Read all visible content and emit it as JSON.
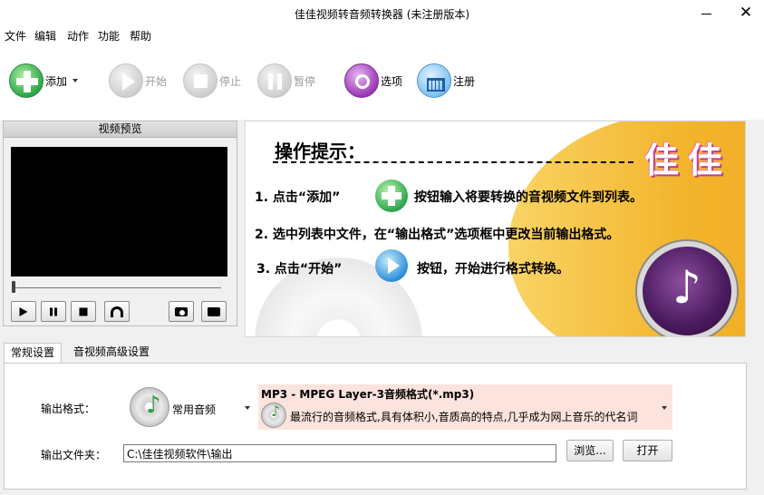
{
  "window": {
    "title": "佳佳视频转音频转换器  (未注册版本)",
    "close_glyph": "✕"
  },
  "menu": [
    "文件",
    "编辑",
    "动作",
    "功能",
    "帮助"
  ],
  "toolbar": {
    "add": "添加",
    "start": "开始",
    "stop": "停止",
    "pause": "暂停",
    "options": "选项",
    "register": "注册"
  },
  "preview": {
    "title": "视频预览"
  },
  "banner": {
    "heading": "操作提示：",
    "brand": "佳佳",
    "step1_a": "1. 点击“添加”",
    "step1_b": "按钮输入将要转换的音视频文件到列表。",
    "step2": "2. 选中列表中文件，在“输出格式”选项框中更改当前输出格式。",
    "step3_a": "3. 点击“开始”",
    "step3_b": "按钮，开始进行格式转换。",
    "music_glyph": "♪"
  },
  "tabs": [
    "常规设置",
    "音视频高级设置"
  ],
  "settings": {
    "format_label": "输出格式：",
    "format_category": "常用音频",
    "format_name": "MP3 - MPEG Layer-3音频格式(*.mp3)",
    "format_desc": "最流行的音频格式,具有体积小,音质高的特点,几乎成为网上音乐的代名词",
    "folder_label": "输出文件夹：",
    "folder_value": "C:\\佳佳视频软件\\输出",
    "browse": "浏览...",
    "open": "打开"
  }
}
